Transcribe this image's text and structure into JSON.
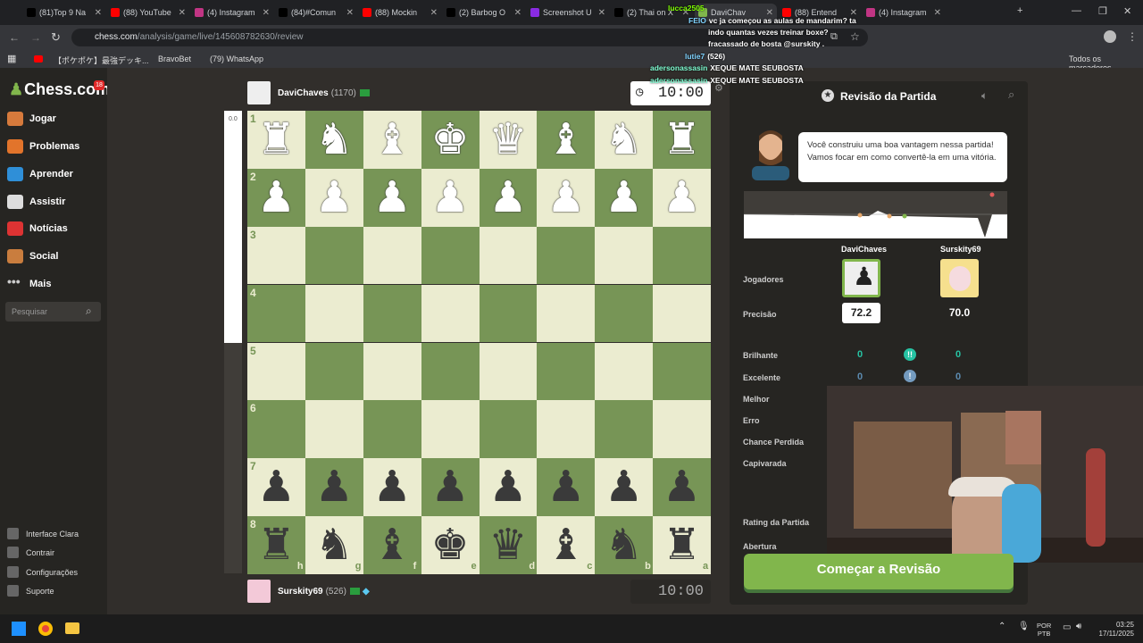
{
  "browser": {
    "tabs": [
      {
        "label": "(81)Top 9 Na",
        "color": "#000000"
      },
      {
        "label": "(88) YouTube",
        "color": "#ff0000"
      },
      {
        "label": "(4) Instagram",
        "color": "#c13584"
      },
      {
        "label": "(84)#Comun",
        "color": "#000000"
      },
      {
        "label": "(88) Mockin",
        "color": "#ff0000"
      },
      {
        "label": "(2) Barbog O",
        "color": "#000000"
      },
      {
        "label": "Screenshot U",
        "color": "#8a2be2"
      },
      {
        "label": "(2) Thai on X",
        "color": "#000000"
      },
      {
        "label": "DaviChav",
        "color": "#81b64c"
      },
      {
        "label": "(88) Entend",
        "color": "#ff0000"
      },
      {
        "label": "(4) Instagram",
        "color": "#c13584"
      }
    ],
    "url_domain": "chess.com",
    "url_path": "/analysis/game/live/145608782630/review",
    "bookmarks": [
      "【ポケポケ】最強デッキ...",
      "BravoBet",
      "(79) WhatsApp",
      "Todos os marcadores"
    ]
  },
  "sidebar": {
    "logo": "Chess.com",
    "badge": "18",
    "items": [
      "Jogar",
      "Problemas",
      "Aprender",
      "Assistir",
      "Notícias",
      "Social",
      "Mais"
    ],
    "search_placeholder": "Pesquisar",
    "bottom": [
      "Interface Clara",
      "Contrair",
      "Configurações",
      "Suporte"
    ]
  },
  "game": {
    "top_player": {
      "name": "DaviChaves",
      "rating": "(1170)",
      "clock": "10:00"
    },
    "bottom_player": {
      "name": "Surskity69",
      "rating": "(526)",
      "clock": "10:00"
    },
    "eval": "0.0",
    "ranks": [
      "1",
      "2",
      "3",
      "4",
      "5",
      "6",
      "7",
      "8"
    ],
    "files": [
      "h",
      "g",
      "f",
      "e",
      "d",
      "c",
      "b",
      "a"
    ],
    "board": [
      [
        "wR",
        "wN",
        "wB",
        "wK",
        "wQ",
        "wB",
        "wN",
        "wR"
      ],
      [
        "wP",
        "wP",
        "wP",
        "wP",
        "wP",
        "wP",
        "wP",
        "wP"
      ],
      [
        "",
        "",
        "",
        "",
        "",
        "",
        "",
        ""
      ],
      [
        "",
        "",
        "",
        "",
        "",
        "",
        "",
        ""
      ],
      [
        "",
        "",
        "",
        "",
        "",
        "",
        "",
        ""
      ],
      [
        "",
        "",
        "",
        "",
        "",
        "",
        "",
        ""
      ],
      [
        "bP",
        "bP",
        "bP",
        "bP",
        "bP",
        "bP",
        "bP",
        "bP"
      ],
      [
        "bR",
        "bN",
        "bB",
        "bK",
        "bQ",
        "bB",
        "bN",
        "bR"
      ]
    ]
  },
  "review": {
    "title": "Revisão da Partida",
    "coach_text": "Você construiu uma boa vantagem nessa partida! Vamos focar em como convertê-la em uma vitória.",
    "players": [
      "DaviChaves",
      "Surskity69"
    ],
    "labels": {
      "players": "Jogadores",
      "accuracy": "Precisão",
      "brilliant": "Brilhante",
      "excellent": "Excelente",
      "best": "Melhor",
      "mistake": "Erro",
      "missed": "Chance Perdida",
      "blunder": "Capivarada",
      "rating": "Rating da Partida",
      "opening": "Abertura"
    },
    "accuracy": [
      "72.2",
      "70.0"
    ],
    "brilliant": [
      "0",
      "0"
    ],
    "excellent": [
      "0",
      "0"
    ],
    "start_button": "Começar a Revisão"
  },
  "chat": [
    {
      "user": "lucca2505",
      "msg": "",
      "color": "#7fff00"
    },
    {
      "user": "FEIO",
      "msg": "vc ja começou as aulas de mandarim? ta",
      "color": "#7fd3ff"
    },
    {
      "user": "",
      "msg": "indo quantas vezes treinar boxe?",
      "color": "#ffffff"
    },
    {
      "user": "",
      "msg": "fracassado de bosta @surskity .",
      "color": "#ffffff"
    },
    {
      "user": "lutie7",
      "msg": "(526)",
      "color": "#7fd3ff"
    },
    {
      "user": "adersonassasin",
      "msg": "XEQUE MATE SEUBOSTA",
      "color": "#7fffd4"
    },
    {
      "user": "adersonassasin",
      "msg": "XEQUE MATE SEUBOSTA",
      "color": "#7fffd4"
    }
  ],
  "taskbar": {
    "lang1": "POR",
    "lang2": "PTB",
    "time": "03:25",
    "date": "17/11/2025"
  }
}
